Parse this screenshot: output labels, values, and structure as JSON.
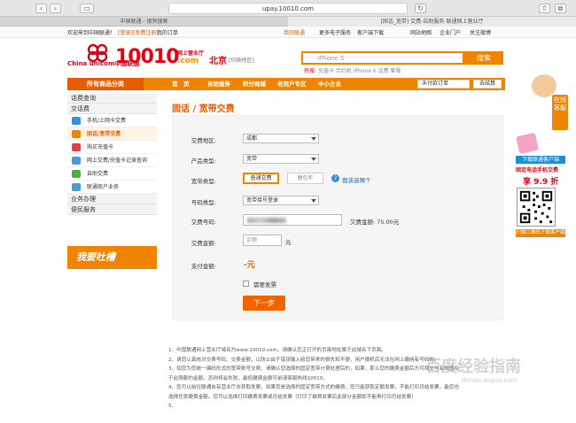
{
  "browser": {
    "url": "upay.10010.com",
    "tabs": [
      {
        "label": "中国联通 - 搜狗搜索",
        "active": false
      },
      {
        "label": "[固话_宽带] 交费-自助服务-联通网上营业厅",
        "active": true
      }
    ]
  },
  "topbar": {
    "welcome": "欢迎来到中国联通！",
    "login": "[登录]",
    "register": "[免费注册]",
    "my_order": "我的订单",
    "links": [
      "我的联通",
      "更多电子服务",
      "客户端下载",
      "网站地图",
      "企业门户",
      "关注微博"
    ]
  },
  "header": {
    "logo_china": "China unicom中国联通",
    "logo_number": "10010",
    "logo_com": ".com",
    "logo_hall": "网上营业厅",
    "city": "北京",
    "city_switch": "[切换地区]",
    "search_placeholder": "iPhone 5",
    "search_button": "搜索",
    "hot_label": "热搜:",
    "hot_words": "充值卡  合约机  iPhone 6  话费  套餐"
  },
  "nav": {
    "all_products": "所有商品分类",
    "items": [
      "首　页",
      "自助服务",
      "积分商城",
      "老用户专区",
      "中小企业"
    ],
    "order_dropdown": "未付款订单",
    "cart": "去结算"
  },
  "sidebar": {
    "sections": [
      {
        "title": "话费查询",
        "items": []
      },
      {
        "title": "交话费",
        "items": [
          {
            "label": "手机/上网卡交费",
            "active": false,
            "color": "#3a8fd6"
          },
          {
            "label": "固话/宽带交费",
            "active": true,
            "color": "#f08300"
          },
          {
            "label": "购买充值卡",
            "active": false,
            "color": "#e04040"
          },
          {
            "label": "网上交费/充值卡记录查询",
            "active": false,
            "color": "#4a9ad8"
          },
          {
            "label": "自助交费",
            "active": false,
            "color": "#55a84a"
          },
          {
            "label": "联通商户业务",
            "active": false,
            "color": "#4a9ad8"
          }
        ]
      },
      {
        "title": "业务办理",
        "items": []
      },
      {
        "title": "便民服务",
        "items": []
      }
    ],
    "complain_banner": "我要吐槽"
  },
  "form": {
    "title": "固话 / 宽带交费",
    "area_label": "交费地区:",
    "area_value": "成都",
    "product_label": "产品类型:",
    "product_value": "宽带",
    "type_label": "宽带类型:",
    "type_options": [
      "普通交费",
      "缴包年"
    ],
    "type_selected": "普通交费",
    "help_link": "我该选哪个",
    "number_type_label": "号码类型:",
    "number_type_value": "宽带接号登录",
    "number_label": "交费号码:",
    "owe_label": "欠费金额:",
    "owe_value": "75.00元",
    "amount_label": "交费金额:",
    "amount_placeholder": "金额",
    "amount_unit": "元",
    "pay_label": "支付金额:",
    "pay_value": "-元",
    "invoice_label": "需要发票",
    "next_button": "下一步"
  },
  "notes": [
    "1、中国联通网上营业厅域名为www.10010.com，请确认您正打开的页面地址属于此域名下页面。",
    "2、请您认真核对交费号码、交费金额，以防止由于错误输入给您带来的损失和不便，用户撤机后无法在网上缴纳有号码的。",
    "3、如您为您统一编码形式的宽带账号交费，请确认您选择的固定宽带计费处理后的，如果，那么您的缴费金额后方可续交与有效值及",
    "于此限额的金额。否则将会失败，最低缴费金额可前请客服热线10010。",
    "4、您可以前往联通自有营业厅去获取发票，如果您是选择的固定宽带方式的缴费，您只能获取定额发票，不能打印月结发票，能您也",
    "选择任意缴费金额。您可以选择打印缴费发票或月结发票（打印了缴费发票后此部分金额即不能再打印月结发票）",
    "5、"
  ],
  "right_ads": {
    "service": "在线客服",
    "ad_line1": "下载联通客户端",
    "ad_line2": "固定电话手机交费",
    "ad_price": "享 9.9 折",
    "qr_caption": "扫描二维码下载客户端"
  },
  "watermark": {
    "text": "百度经验指南",
    "sub": "zhinan.sogou.com"
  }
}
